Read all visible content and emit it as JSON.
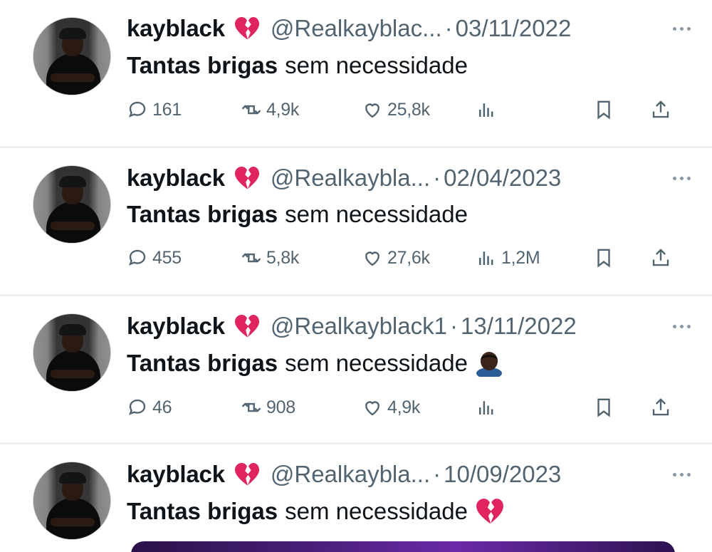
{
  "tweets": [
    {
      "name": "kayblack",
      "handle": "@Realkayblac...",
      "dot": "·",
      "date": "03/11/2022",
      "text_bold": "Tantas brigas",
      "text_rest": "sem necessidade",
      "emoji": "",
      "replies": "161",
      "retweets": "4,9k",
      "likes": "25,8k",
      "views": ""
    },
    {
      "name": "kayblack",
      "handle": "@Realkaybla...",
      "dot": "·",
      "date": "02/04/2023",
      "text_bold": "Tantas brigas",
      "text_rest": "sem necessidade",
      "emoji": "",
      "replies": "455",
      "retweets": "5,8k",
      "likes": "27,6k",
      "views": "1,2M"
    },
    {
      "name": "kayblack",
      "handle": "@Realkayblack1",
      "dot": "·",
      "date": "13/11/2022",
      "text_bold": "Tantas brigas",
      "text_rest": "sem necessidade",
      "emoji": "person-bowing-dark-skin-tone",
      "replies": "46",
      "retweets": "908",
      "likes": "4,9k",
      "views": ""
    },
    {
      "name": "kayblack",
      "handle": "@Realkaybla...",
      "dot": "·",
      "date": "10/09/2023",
      "text_bold": "Tantas brigas",
      "text_rest": "sem necessidade",
      "emoji": "broken-heart",
      "replies": "",
      "retweets": "",
      "likes": "",
      "views": ""
    }
  ],
  "colors": {
    "text": "#0f1419",
    "secondary": "#536471",
    "divider": "#eef0f2",
    "heart_red": "#e0245e"
  },
  "icons": {
    "name_badge": "broken-heart-icon",
    "reply": "reply-icon",
    "retweet": "retweet-icon",
    "like": "like-icon",
    "views": "views-icon",
    "bookmark": "bookmark-icon",
    "share": "share-icon",
    "more": "more-icon"
  }
}
